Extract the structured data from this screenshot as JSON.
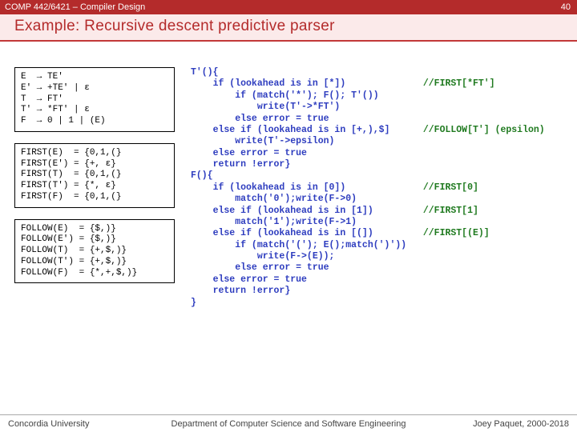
{
  "header": {
    "course": "COMP 442/6421 – Compiler Design",
    "page_no": "40"
  },
  "title": "Example: Recursive descent predictive parser",
  "grammar_box": "E  → TE'\nE' → +TE' | ε\nT  → FT'\nT' → *FT' | ε\nF  → 0 | 1 | (E)",
  "first_box": "FIRST(E)  = {0,1,(}\nFIRST(E') = {+, ε}\nFIRST(T)  = {0,1,(}\nFIRST(T') = {*, ε}\nFIRST(F)  = {0,1,(}",
  "follow_box": "FOLLOW(E)  = {$,)}\nFOLLOW(E') = {$,)}\nFOLLOW(T)  = {+,$,)}\nFOLLOW(T') = {+,$,)}\nFOLLOW(F)  = {*,+,$,)}",
  "code_lines": [
    {
      "t": "T'(){"
    },
    {
      "t": "    if (lookahead is in [*])",
      "c": "//FIRST[*FT']"
    },
    {
      "t": "        if (match('*'); F(); T'())"
    },
    {
      "t": "            write(T'->*FT')"
    },
    {
      "t": "        else error = true"
    },
    {
      "t": "    else if (lookahead is in [+,),$]",
      "c": "//FOLLOW[T'] (epsilon)"
    },
    {
      "t": "        write(T'->epsilon)"
    },
    {
      "t": "    else error = true"
    },
    {
      "t": "    return !error}"
    },
    {
      "t": "F(){"
    },
    {
      "t": "    if (lookahead is in [0])",
      "c": "//FIRST[0]"
    },
    {
      "t": "        match('0');write(F->0)"
    },
    {
      "t": "    else if (lookahead is in [1])",
      "c": "//FIRST[1]"
    },
    {
      "t": "        match('1');write(F->1)"
    },
    {
      "t": "    else if (lookahead is in [(])",
      "c": "//FIRST[(E)]"
    },
    {
      "t": "        if (match('('); E();match(')'))"
    },
    {
      "t": "            write(F->(E));"
    },
    {
      "t": "        else error = true"
    },
    {
      "t": "    else error = true"
    },
    {
      "t": "    return !error}"
    },
    {
      "t": "}"
    }
  ],
  "footer": {
    "left": "Concordia University",
    "center": "Department of Computer Science and Software Engineering",
    "right": "Joey Paquet, 2000-2018"
  }
}
